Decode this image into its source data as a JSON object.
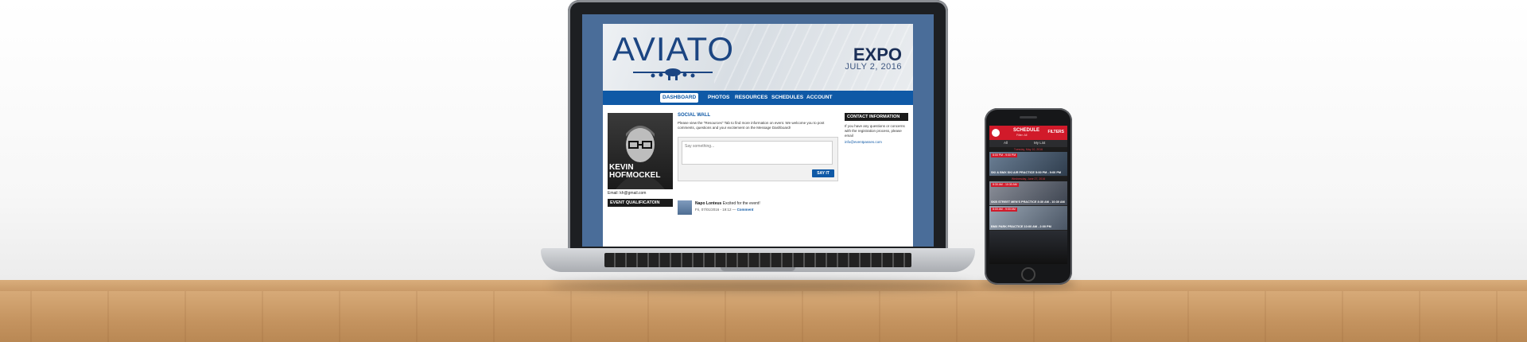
{
  "site": {
    "logo_text": "AVIATO",
    "event_name": "EXPO",
    "event_date": "JULY 2, 2016",
    "nav": [
      {
        "label": "DASHBOARD",
        "active": true
      },
      {
        "label": "PHOTOS",
        "active": false
      },
      {
        "label": "RESOURCES",
        "active": false
      },
      {
        "label": "SCHEDULES",
        "active": false
      },
      {
        "label": "ACCOUNT",
        "active": false
      }
    ],
    "profile": {
      "first_name": "KEVIN",
      "last_name": "HOFMOCKEL",
      "email": "Email: kh@gmail.com"
    },
    "event_qualification_title": "EVENT QUALIFICATOIN",
    "social_wall": {
      "title": "SOCIAL WALL",
      "intro": "Please view the \"Resources\" Tab to find more information on event. We welcome you to post comments, questions and your excitement on the Message Dashboard!",
      "placeholder": "Say something...",
      "button": "SAY IT",
      "post": {
        "author": "Napo Lonteus",
        "text": "Excited for the event!",
        "meta": "Fri, 07/01/2016 - 19:12",
        "link": "Comment"
      }
    },
    "contact": {
      "title": "CONTACT INFORMATION",
      "text": "If you have any questions or concerns with the registration process, please email",
      "email": "info@eventpasses.com"
    }
  },
  "phone_app": {
    "title": "SCHEDULE",
    "subtitle": "Filter: All",
    "filters_label": "FILTERS",
    "tabs": [
      "All",
      "My List"
    ],
    "days": [
      {
        "date": "Tuesday, May 10, 2016",
        "cards": [
          {
            "time": "8:00 PM - 9:00 PM",
            "title": "SKI & BMX SKI AIR PRACTICE 5:00 PM - 9:00 PM"
          }
        ]
      },
      {
        "date": "Wednesday, June 27, 2016",
        "cards": [
          {
            "time": "8:30 AM - 10:30 AM",
            "title": "SKB STREET MEN'S PRACTICE 8:30 AM - 10:30 AM"
          },
          {
            "time": "8:00 AM - 9:00 AM",
            "title": "BMX PARK PRACTICE 10:00 AM - 2:00 PM"
          }
        ]
      }
    ]
  },
  "colors": {
    "brand_blue": "#0f59a6",
    "logo_navy": "#1b4582",
    "app_red": "#d11a2a"
  }
}
